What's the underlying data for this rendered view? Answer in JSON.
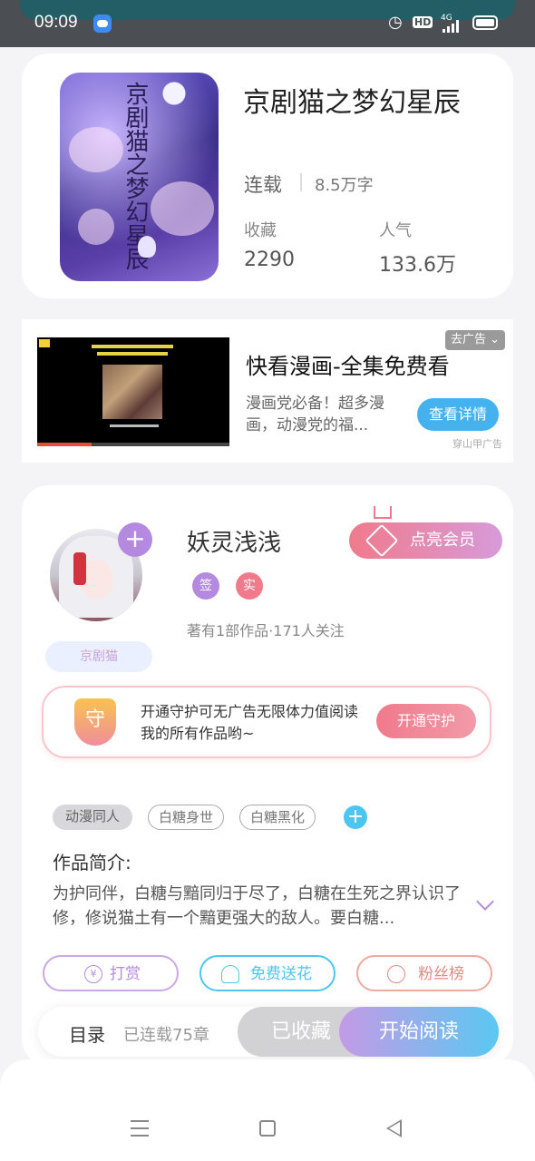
{
  "status_bar": {
    "time": "09:09",
    "network": "4G",
    "hd": "HD"
  },
  "book": {
    "title": "京剧猫之梦幻星辰",
    "cover_title": "京剧猫之梦幻星辰",
    "status": "连载",
    "word_count": "8.5万字",
    "favorites_label": "收藏",
    "favorites_value": "2290",
    "popularity_label": "人气",
    "popularity_value": "133.6万"
  },
  "ad": {
    "close_label": "去广告 ⌄",
    "title": "快看漫画-全集免费看",
    "description": "漫画党必备！超多漫画，动漫党的福...",
    "button_label": "查看详情",
    "source": "穿山甲广告"
  },
  "author": {
    "name": "妖灵浅浅",
    "plus": "+",
    "tag": "京剧猫",
    "badge_sign": "签",
    "badge_real": "实",
    "meta": "著有1部作品·171人关注",
    "vip_label": "点亮会员"
  },
  "guard": {
    "icon_text": "守",
    "text": "开通守护可无广告无限体力值阅读我的所有作品哟~",
    "button_label": "开通守护"
  },
  "genre_tags": [
    "动漫同人",
    "白糖身世",
    "白糖黑化"
  ],
  "genre_add": "+",
  "intro": {
    "heading": "作品简介:",
    "body": "为护同伴，白糖与黯同归于尽了，白糖在生死之界认识了修，修说猫土有一个黯更强大的敌人。要白糖..."
  },
  "actions": {
    "reward": "打赏",
    "flower": "免费送花",
    "fans": "粉丝榜",
    "reward_icon": "¥"
  },
  "bottom_bar": {
    "catalog": "目录",
    "serial_count": "已连载75章",
    "collected": "已收藏",
    "start_reading": "开始阅读"
  },
  "colors": {
    "accent_purple": "#b48ae0",
    "accent_pink": "#f07a8c",
    "accent_blue": "#45b2f0",
    "flower_cyan": "#4cc6f0"
  }
}
